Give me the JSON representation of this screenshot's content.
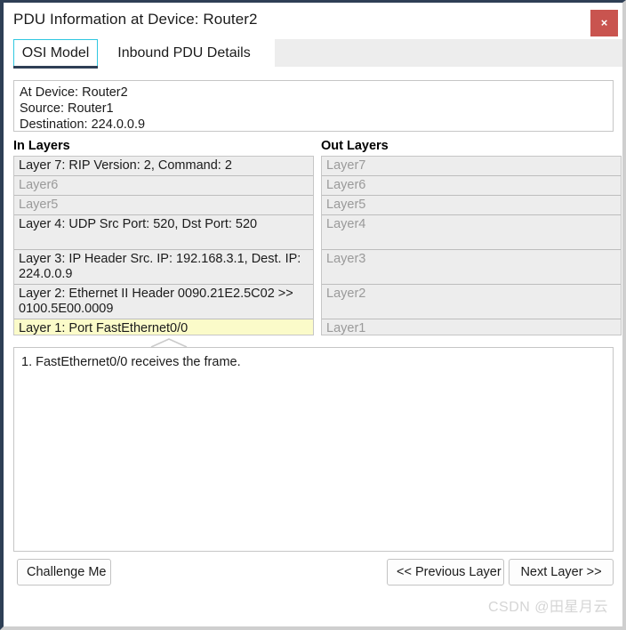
{
  "window": {
    "title": "PDU Information at Device: Router2",
    "close_label": "×"
  },
  "tabs": [
    {
      "label": "OSI Model",
      "selected": true
    },
    {
      "label": "Inbound PDU Details",
      "selected": false
    }
  ],
  "info": {
    "at_device": "At Device: Router2",
    "source": "Source: Router1",
    "destination": "Destination: 224.0.0.9"
  },
  "in_layers": {
    "header": "In Layers",
    "rows": [
      {
        "text": "Layer 7: RIP Version: 2, Command: 2",
        "dim": false,
        "selected": false
      },
      {
        "text": "Layer6",
        "dim": true,
        "selected": false
      },
      {
        "text": "Layer5",
        "dim": true,
        "selected": false
      },
      {
        "text": "Layer 4: UDP Src Port: 520, Dst Port: 520",
        "dim": false,
        "selected": false
      },
      {
        "text": "Layer 3: IP Header Src. IP: 192.168.3.1, Dest. IP: 224.0.0.9",
        "dim": false,
        "selected": false
      },
      {
        "text": "Layer 2: Ethernet II Header 0090.21E2.5C02 >> 0100.5E00.0009",
        "dim": false,
        "selected": false
      },
      {
        "text": "Layer 1: Port FastEthernet0/0",
        "dim": false,
        "selected": true
      }
    ]
  },
  "out_layers": {
    "header": "Out Layers",
    "rows": [
      {
        "text": "Layer7",
        "dim": true,
        "selected": false
      },
      {
        "text": "Layer6",
        "dim": true,
        "selected": false
      },
      {
        "text": "Layer5",
        "dim": true,
        "selected": false
      },
      {
        "text": "Layer4",
        "dim": true,
        "selected": false
      },
      {
        "text": "Layer3",
        "dim": true,
        "selected": false
      },
      {
        "text": "Layer2",
        "dim": true,
        "selected": false
      },
      {
        "text": "Layer1",
        "dim": true,
        "selected": false
      }
    ]
  },
  "description": {
    "lines": [
      "1. FastEthernet0/0 receives the frame."
    ]
  },
  "footer": {
    "challenge_label": "Challenge Me",
    "previous_label": "<< Previous Layer",
    "next_label": "Next Layer >>"
  },
  "watermark": {
    "text": "CSDN @田星月云"
  },
  "colors": {
    "titlebar_border": "#2e3f55",
    "close_button": "#c9544f",
    "tab_focus": "#30c7e0",
    "tab_underline": "#2e3f55",
    "row_background": "#ededed",
    "row_selected": "#fbfbc9",
    "dim_text": "#9a9a9a"
  }
}
